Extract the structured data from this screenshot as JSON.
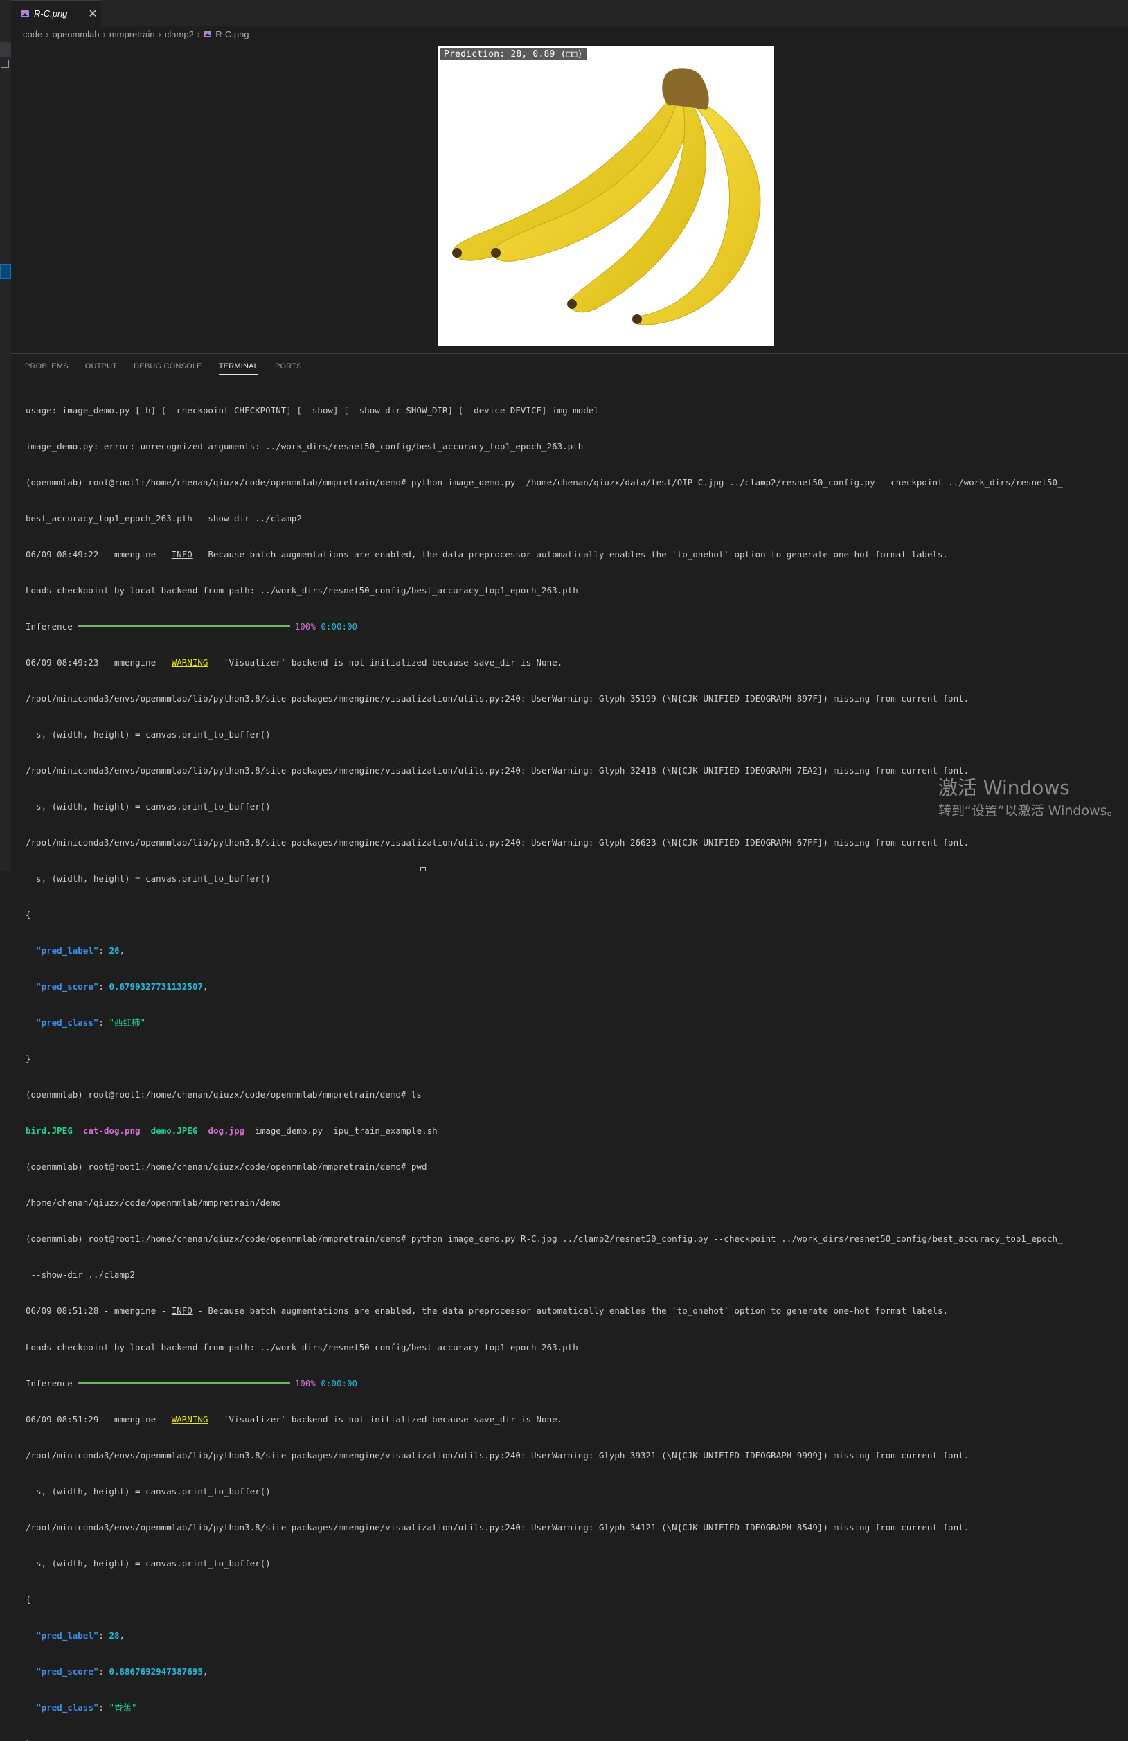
{
  "tab": {
    "label": "R-C.png",
    "close": "✕"
  },
  "breadcrumb": [
    "code",
    "openmmlab",
    "mmpretrain",
    "clamp2",
    "R-C.png"
  ],
  "preview": {
    "prediction_label": "Prediction: 28, 0.89 (□□)"
  },
  "panel": {
    "tabs": [
      "PROBLEMS",
      "OUTPUT",
      "DEBUG CONSOLE",
      "TERMINAL",
      "PORTS"
    ],
    "active_tab": "TERMINAL"
  },
  "terminal": {
    "l01": "usage: image_demo.py [-h] [--checkpoint CHECKPOINT] [--show] [--show-dir SHOW_DIR] [--device DEVICE] img model",
    "l02": "image_demo.py: error: unrecognized arguments: ../work_dirs/resnet50_config/best_accuracy_top1_epoch_263.pth",
    "l03": "(openmmlab) root@root1:/home/chenan/qiuzx/code/openmmlab/mmpretrain/demo# python image_demo.py  /home/chenan/qiuzx/data/test/OIP-C.jpg ../clamp2/resnet50_config.py --checkpoint ../work_dirs/resnet50_",
    "l04": "best_accuracy_top1_epoch_263.pth --show-dir ../clamp2",
    "l05_a": "06/09 08:49:22 - mmengine - ",
    "l05_b": "INFO",
    "l05_c": " - Because batch augmentations are enabled, the data preprocessor automatically enables the `to_onehot` option to generate one-hot format labels.",
    "l06": "Loads checkpoint by local backend from path: ../work_dirs/resnet50_config/best_accuracy_top1_epoch_263.pth",
    "l07_a": "Inference",
    "l07_pct": "100%",
    "l07_time": "0:00:00",
    "l08_a": "06/09 08:49:23 - mmengine - ",
    "l08_b": "WARNING",
    "l08_c": " - `Visualizer` backend is not initialized because save_dir is None.",
    "l09": "/root/miniconda3/envs/openmmlab/lib/python3.8/site-packages/mmengine/visualization/utils.py:240: UserWarning: Glyph 35199 (\\N{CJK UNIFIED IDEOGRAPH-897F}) missing from current font.",
    "l10": "  s, (width, height) = canvas.print_to_buffer()",
    "l11": "/root/miniconda3/envs/openmmlab/lib/python3.8/site-packages/mmengine/visualization/utils.py:240: UserWarning: Glyph 32418 (\\N{CJK UNIFIED IDEOGRAPH-7EA2}) missing from current font.",
    "l12": "  s, (width, height) = canvas.print_to_buffer()",
    "l13": "/root/miniconda3/envs/openmmlab/lib/python3.8/site-packages/mmengine/visualization/utils.py:240: UserWarning: Glyph 26623 (\\N{CJK UNIFIED IDEOGRAPH-67FF}) missing from current font.",
    "l14": "  s, (width, height) = canvas.print_to_buffer()",
    "l15": "{",
    "l16_k": "\"pred_label\"",
    "l16_v": "26",
    "l17_k": "\"pred_score\"",
    "l17_v": "0.6799327731132507",
    "l18_k": "\"pred_class\"",
    "l18_v": "\"西红柿\"",
    "l19": "}",
    "l20": "(openmmlab) root@root1:/home/chenan/qiuzx/code/openmmlab/mmpretrain/demo# ls",
    "l21_f1": "bird.JPEG",
    "l21_f2": "cat-dog.png",
    "l21_f3": "demo.JPEG",
    "l21_f4": "dog.jpg",
    "l21_f5": "image_demo.py",
    "l21_f6": "ipu_train_example.sh",
    "l22": "(openmmlab) root@root1:/home/chenan/qiuzx/code/openmmlab/mmpretrain/demo# pwd",
    "l23": "/home/chenan/qiuzx/code/openmmlab/mmpretrain/demo",
    "l24": "(openmmlab) root@root1:/home/chenan/qiuzx/code/openmmlab/mmpretrain/demo# python image_demo.py R-C.jpg ../clamp2/resnet50_config.py --checkpoint ../work_dirs/resnet50_config/best_accuracy_top1_epoch_",
    "l25": " --show-dir ../clamp2",
    "l26_a": "06/09 08:51:28 - mmengine - ",
    "l26_b": "INFO",
    "l26_c": " - Because batch augmentations are enabled, the data preprocessor automatically enables the `to_onehot` option to generate one-hot format labels.",
    "l27": "Loads checkpoint by local backend from path: ../work_dirs/resnet50_config/best_accuracy_top1_epoch_263.pth",
    "l28_a": "Inference",
    "l28_pct": "100%",
    "l28_time": "0:00:00",
    "l29_a": "06/09 08:51:29 - mmengine - ",
    "l29_b": "WARNING",
    "l29_c": " - `Visualizer` backend is not initialized because save_dir is None.",
    "l30": "/root/miniconda3/envs/openmmlab/lib/python3.8/site-packages/mmengine/visualization/utils.py:240: UserWarning: Glyph 39321 (\\N{CJK UNIFIED IDEOGRAPH-9999}) missing from current font.",
    "l31": "  s, (width, height) = canvas.print_to_buffer()",
    "l32": "/root/miniconda3/envs/openmmlab/lib/python3.8/site-packages/mmengine/visualization/utils.py:240: UserWarning: Glyph 34121 (\\N{CJK UNIFIED IDEOGRAPH-8549}) missing from current font.",
    "l33": "  s, (width, height) = canvas.print_to_buffer()",
    "l34": "{",
    "l35_k": "\"pred_label\"",
    "l35_v": "28",
    "l36_k": "\"pred_score\"",
    "l36_v": "0.8867692947387695",
    "l37_k": "\"pred_class\"",
    "l37_v": "\"香蕉\"",
    "l38": "}"
  },
  "watermark": {
    "line1": "激活 Windows",
    "line2": "转到“设置”以激活 Windows。"
  },
  "colors": {
    "progress": "#6bb85c",
    "warning": "#e5e510",
    "json_key": "#3b8eea",
    "json_number": "#29b8db",
    "json_string": "#23d18b"
  }
}
